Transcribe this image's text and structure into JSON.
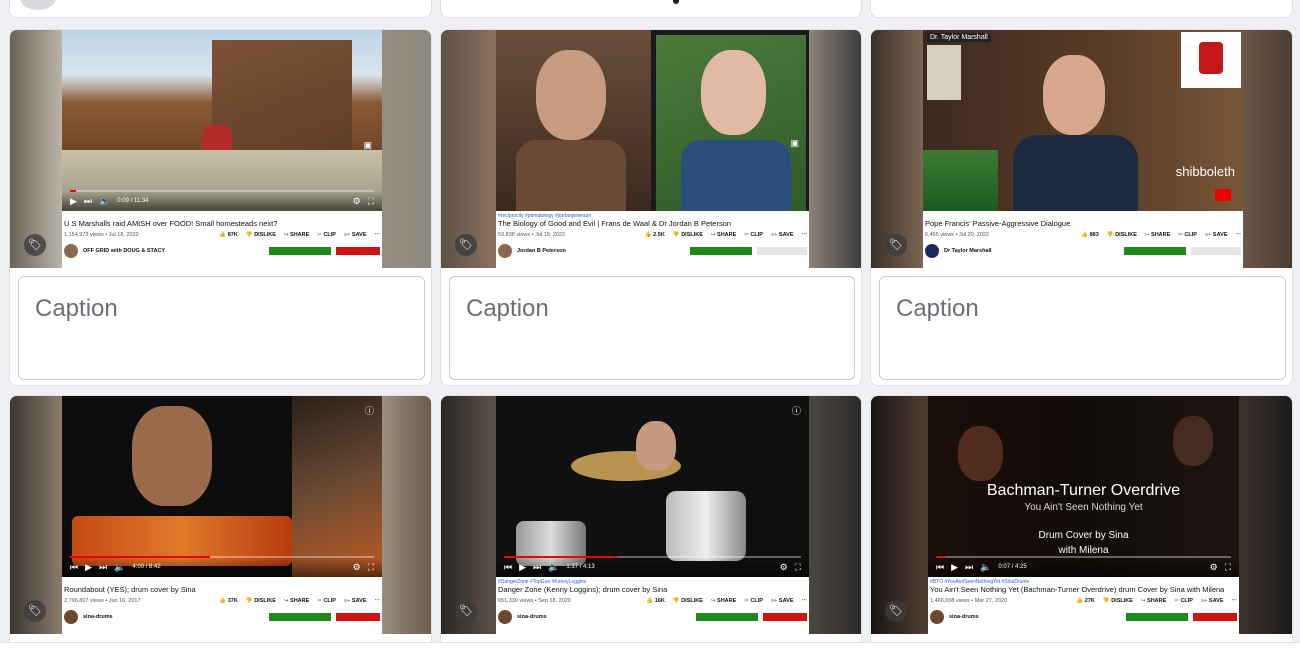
{
  "caption_placeholder": "Caption",
  "card_tag_icon": "tag-icon",
  "actions": {
    "dislike": "DISLIKE",
    "share": "SHARE",
    "clip": "CLIP",
    "save": "SAVE",
    "more": "⋯"
  },
  "cards": [
    {
      "title": "U S Marshalls raid AMISH over FOOD! Small homesteads next?",
      "views": "1,154,973 views • Jul 18, 2022",
      "likes": "87K",
      "channel": "OFF GRID with DOUG & STACY",
      "time": "0:09 / 11:34",
      "hashtags": ""
    },
    {
      "title": "The Biology of Good and Evil | Frans de Waal & Dr Jordan B Peterson",
      "views": "53,838 views • Jul 19, 2022",
      "likes": "2.5K",
      "channel": "Jordan B Peterson",
      "time": "",
      "hashtags": "#reciprocity #primatology #jordanpeterson"
    },
    {
      "title": "Pope Francis' Passive-Aggressive Dialogue",
      "views": "6,465 views • Jul 20, 2022",
      "likes": "883",
      "channel": "Dr Taylor Marshall",
      "time": "",
      "hashtags": "",
      "overlay_name": "Dr. Taylor Marshall",
      "overlay_word": "shibboleth"
    },
    {
      "title": "Roundabout (YES); drum cover by Sina",
      "views": "2,796,807 views • Jun 16, 2017",
      "likes": "37K",
      "channel": "sina-drums",
      "time": "4:00 / 8:42",
      "hashtags": ""
    },
    {
      "title": "Danger Zone (Kenny Loggins); drum cover by Sina",
      "views": "651,330 views • Sep 18, 2020",
      "likes": "16K",
      "channel": "sina-drums",
      "time": "1:37 / 4:13",
      "hashtags": "#DangerZone #TopGun #KennyLoggins"
    },
    {
      "title": "You Ain't Seen Nothing Yet (Bachman-Turner Overdrive) drum Cover by Sina with Milena",
      "views": "1,466,008 views • Mar 27, 2020",
      "likes": "27K",
      "channel": "sina-drums",
      "time": "0:07 / 4:25",
      "hashtags": "#BTO #YouAintSeenNothingYet #SinaDrums",
      "overlay_band": "Bachman-Turner Overdrive",
      "overlay_song": "You Ain't Seen Nothing Yet",
      "overlay_line1": "Drum Cover by Sina",
      "overlay_line2": "with Milena"
    }
  ]
}
